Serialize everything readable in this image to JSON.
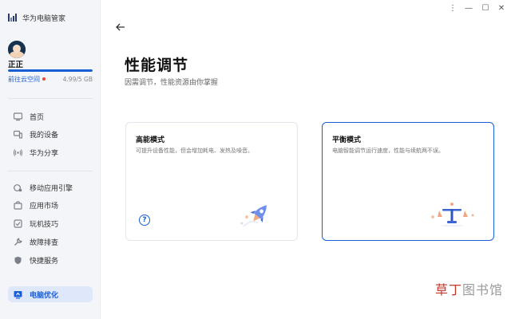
{
  "app": {
    "title": "华为电脑管家"
  },
  "user": {
    "name": "正正",
    "cloud_link": "前往云空间",
    "storage_text": "4.99/5 GB",
    "storage_fraction": 0.998
  },
  "sidebar": {
    "items": [
      {
        "label": "首页",
        "icon": "monitor-icon"
      },
      {
        "label": "我的设备",
        "icon": "devices-icon"
      },
      {
        "label": "华为分享",
        "icon": "share-signal-icon"
      },
      {
        "label": "移动应用引擎",
        "icon": "app-engine-icon"
      },
      {
        "label": "应用市场",
        "icon": "app-store-icon"
      },
      {
        "label": "玩机技巧",
        "icon": "tips-icon"
      },
      {
        "label": "故障排查",
        "icon": "wrench-icon"
      },
      {
        "label": "快捷服务",
        "icon": "shield-icon"
      },
      {
        "label": "电脑优化",
        "icon": "optimize-icon",
        "active": true
      }
    ]
  },
  "window_controls": {
    "menu": "⋮",
    "minimize": "—",
    "maximize": "☐",
    "close": "✕"
  },
  "page": {
    "title": "性能调节",
    "subtitle": "因需调节，性能资源由你掌握"
  },
  "cards": [
    {
      "title": "高能模式",
      "desc": "可提升设备性能，但会增加耗电、发热及噪音。",
      "selected": false,
      "illustration": "rocket-icon"
    },
    {
      "title": "平衡模式",
      "desc": "电脑智能调节运行速度，性能与续航两不误。",
      "selected": true,
      "illustration": "balance-scale-icon"
    }
  ],
  "help": {
    "glyph": "?"
  },
  "watermark": {
    "part1": "草丁",
    "part2": "图书馆"
  },
  "colors": {
    "accent": "#1a5ed6",
    "sidebar_bg": "#f3f5f9",
    "status_dot": "#e8453c"
  }
}
